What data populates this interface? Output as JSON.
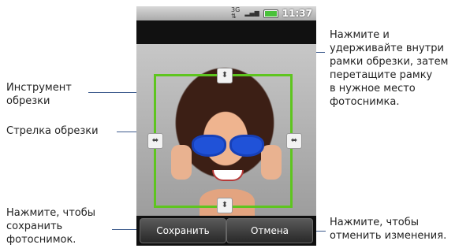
{
  "callouts": {
    "crop_tool": [
      "Инструмент",
      "обрезки"
    ],
    "crop_arrow": "Стрелка обрезки",
    "save": [
      "Нажмите, чтобы",
      "сохранить",
      "фотоснимок."
    ],
    "hold_drag": [
      "Нажмите и",
      "удерживайте внутри",
      "рамки обрезки, затем",
      "перетащите рамку",
      "в нужное место",
      "фотоснимка."
    ],
    "cancel": [
      "Нажмите, чтобы",
      "отменить изменения."
    ]
  },
  "statusbar": {
    "clock": "11:37",
    "icons": [
      "data-3g-icon",
      "signal-icon",
      "battery-icon"
    ],
    "battery_color": "#49c13a"
  },
  "buttons": {
    "save": "Сохранить",
    "cancel": "Отмена"
  },
  "colors": {
    "crop_frame": "#5ec51f",
    "callout_line": "#3c5a8c"
  }
}
